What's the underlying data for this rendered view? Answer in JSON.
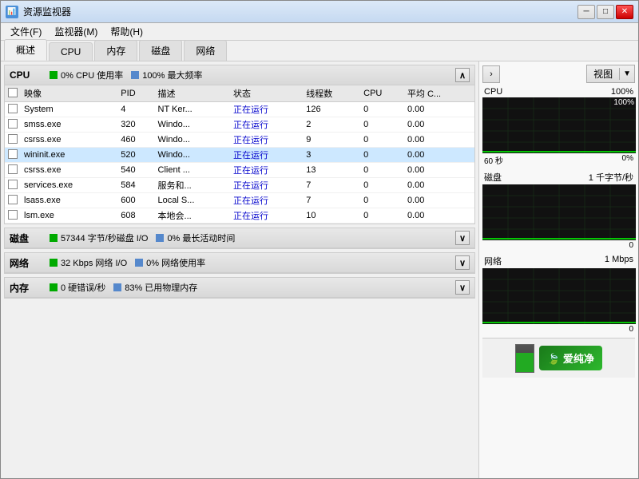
{
  "window": {
    "title": "资源监视器",
    "icon": "📊"
  },
  "menu": {
    "items": [
      "文件(F)",
      "监视器(M)",
      "帮助(H)"
    ]
  },
  "tabs": [
    {
      "label": "概述",
      "active": true
    },
    {
      "label": "CPU",
      "active": false
    },
    {
      "label": "内存",
      "active": false
    },
    {
      "label": "磁盘",
      "active": false
    },
    {
      "label": "网络",
      "active": false
    }
  ],
  "cpu_section": {
    "title": "CPU",
    "usage_label": "0% CPU 使用率",
    "max_freq_label": "100% 最大频率",
    "columns": [
      "映像",
      "PID",
      "描述",
      "状态",
      "线程数",
      "CPU",
      "平均 C..."
    ],
    "processes": [
      {
        "name": "System",
        "pid": "4",
        "desc": "NT Ker...",
        "status": "正在运行",
        "threads": "126",
        "cpu": "0",
        "avg": "0.00"
      },
      {
        "name": "smss.exe",
        "pid": "320",
        "desc": "Windo...",
        "status": "正在运行",
        "threads": "2",
        "cpu": "0",
        "avg": "0.00"
      },
      {
        "name": "csrss.exe",
        "pid": "460",
        "desc": "Windo...",
        "status": "正在运行",
        "threads": "9",
        "cpu": "0",
        "avg": "0.00"
      },
      {
        "name": "wininit.exe",
        "pid": "520",
        "desc": "Windo...",
        "status": "正在运行",
        "threads": "3",
        "cpu": "0",
        "avg": "0.00",
        "selected": true
      },
      {
        "name": "csrss.exe",
        "pid": "540",
        "desc": "Client ...",
        "status": "正在运行",
        "threads": "13",
        "cpu": "0",
        "avg": "0.00"
      },
      {
        "name": "services.exe",
        "pid": "584",
        "desc": "服务和...",
        "status": "正在运行",
        "threads": "7",
        "cpu": "0",
        "avg": "0.00"
      },
      {
        "name": "lsass.exe",
        "pid": "600",
        "desc": "Local S...",
        "status": "正在运行",
        "threads": "7",
        "cpu": "0",
        "avg": "0.00"
      },
      {
        "name": "lsm.exe",
        "pid": "608",
        "desc": "本地会...",
        "status": "正在运行",
        "threads": "10",
        "cpu": "0",
        "avg": "0.00"
      }
    ]
  },
  "disk_section": {
    "title": "磁盘",
    "io_label": "57344 字节/秒磁盘 I/O",
    "active_label": "0% 最长活动时间"
  },
  "network_section": {
    "title": "网络",
    "io_label": "32 Kbps 网络 I/O",
    "usage_label": "0% 网络使用率"
  },
  "memory_section": {
    "title": "内存",
    "errors_label": "0 硬错误/秒",
    "usage_label": "83% 已用物理内存"
  },
  "right_panel": {
    "view_label": "视图",
    "cpu_chart": {
      "label": "CPU",
      "value": "100%",
      "time_label": "60 秒",
      "zero_label": "0%"
    },
    "disk_chart": {
      "label": "磁盘",
      "value": "1 千字节/秒",
      "zero_label": "0"
    },
    "network_chart": {
      "label": "网络",
      "value": "1 Mbps",
      "zero_label": "0"
    }
  },
  "brand": {
    "label": "爱纯净",
    "url": "aichunjing.com"
  }
}
